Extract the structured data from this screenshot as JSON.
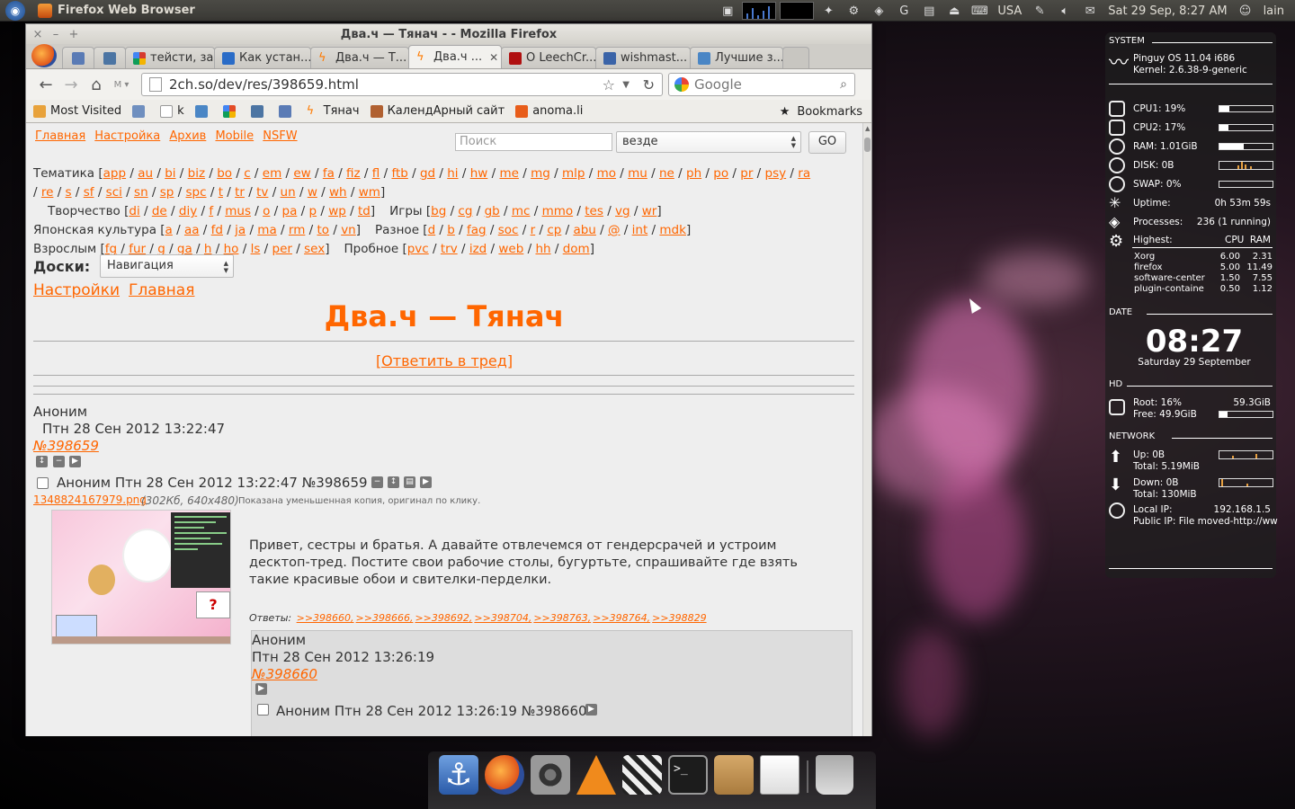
{
  "top_panel": {
    "app_title": "Firefox Web Browser",
    "keyboard_layout": "USA",
    "datetime": "Sat 29 Sep,  8:27 AM",
    "user": "lain"
  },
  "window": {
    "title": "Два.ч — Тянач - - Mozilla Firefox",
    "buttons": [
      "×",
      "–",
      "+"
    ]
  },
  "tabs": [
    {
      "label": "",
      "pinned": true,
      "icon_color": "#5a7bb5"
    },
    {
      "label": "",
      "pinned": true,
      "icon_color": "#4c75a3"
    },
    {
      "label": "тейсти, за...",
      "icon_color": "#d63b2f"
    },
    {
      "label": "Как устан...",
      "icon_color": "#2a6cc7"
    },
    {
      "label": "Два.ч — Т...",
      "icon_color": "#ff7a00"
    },
    {
      "label": "Два.ч ...",
      "icon_color": "#ff7a00",
      "active": true
    },
    {
      "label": "О LeechCr...",
      "icon_color": "#b01010"
    },
    {
      "label": "wishmast...",
      "icon_color": "#3b64a8"
    },
    {
      "label": "Лучшие з...",
      "icon_color": "#4a86c5"
    }
  ],
  "nav": {
    "url": "2ch.so/dev/res/398659.html",
    "search_placeholder": "Google"
  },
  "bookmarks": {
    "items": [
      {
        "label": "Most Visited",
        "icon_color": "#e8a23a"
      },
      {
        "label": "",
        "icon_color": "#6f8fbf"
      },
      {
        "label": "k",
        "icon_color": "#ffffff"
      },
      {
        "label": "",
        "icon_color": "#4a86c5"
      },
      {
        "label": "",
        "icon_color": "#e34c26"
      },
      {
        "label": "",
        "icon_color": "#4c75a3"
      },
      {
        "label": "",
        "icon_color": "#5a7bb5"
      },
      {
        "label": "Тянач",
        "icon_color": "#ff7a00"
      },
      {
        "label": "КалендАрный сайт",
        "icon_color": "#b06030"
      },
      {
        "label": "anoma.li",
        "icon_color": "#e85d1a"
      }
    ],
    "right_label": "Bookmarks"
  },
  "page": {
    "top_links": [
      "Главная",
      "Настройка",
      "Архив",
      "Mobile",
      "NSFW"
    ],
    "search_placeholder": "Поиск",
    "scope_value": "везде",
    "go_label": "GO",
    "board_rows": [
      {
        "cat": "Тематика",
        "boards": [
          "app",
          "au",
          "bi",
          "biz",
          "bo",
          "c",
          "em",
          "ew",
          "fa",
          "fiz",
          "fl",
          "ftb",
          "gd",
          "hi",
          "hw",
          "me",
          "mg",
          "mlp",
          "mo",
          "mu",
          "ne",
          "ph",
          "po",
          "pr",
          "psy",
          "ra"
        ]
      },
      {
        "cat": "",
        "boards": [
          "re",
          "s",
          "sf",
          "sci",
          "sn",
          "sp",
          "spc",
          "t",
          "tr",
          "tv",
          "un",
          "w",
          "wh",
          "wm"
        ],
        "continuation": true
      },
      {
        "cat": "Творчество",
        "boards": [
          "di",
          "de",
          "diy",
          "f",
          "mus",
          "o",
          "pa",
          "p",
          "wp",
          "td"
        ],
        "cat2": "Игры",
        "boards2": [
          "bg",
          "cg",
          "gb",
          "mc",
          "mmo",
          "tes",
          "vg",
          "wr"
        ]
      },
      {
        "cat": "Японская культура",
        "boards": [
          "a",
          "aa",
          "fd",
          "ja",
          "ma",
          "rm",
          "to",
          "vn"
        ],
        "cat2": "Разное",
        "boards2": [
          "d",
          "b",
          "fag",
          "soc",
          "r",
          "cp",
          "abu",
          "@",
          "int",
          "mdk"
        ]
      },
      {
        "cat": "Взрослым",
        "boards": [
          "fg",
          "fur",
          "g",
          "ga",
          "h",
          "ho",
          "ls",
          "per",
          "sex"
        ],
        "cat2": "Пробное",
        "boards2": [
          "pvc",
          "trv",
          "izd",
          "web",
          "hh",
          "dom"
        ]
      }
    ],
    "doski_label": "Доски:",
    "nav_select": "Навигация",
    "link_settings": "Настройки",
    "link_home": "Главная",
    "board_title": "Два.ч — Тянач",
    "reply_link": "[Ответить в тред]",
    "op": {
      "name": "Аноним",
      "date": "Птн 28 Сен 2012 13:22:47",
      "num": "№398659",
      "header": "Аноним  Птн 28 Сен 2012 13:22:47 №398659",
      "file_name": "1348824167979.png",
      "file_meta": "(302Кб, 640x480)",
      "file_note": "Показана уменьшенная копия, оригинал по клику.",
      "body": "Привет, сестры и братья. А давайте отвлечемся от гендерсрачей и устроим десктоп-тред. Постите свои рабочие столы, бугуртьте, спрашивайте где взять такие красивые обои и свителки-перделки.",
      "replies_label": "Ответы:",
      "replies": [
        ">>398660,",
        ">>398666,",
        ">>398692,",
        ">>398704,",
        ">>398763,",
        ">>398764,",
        ">>398829"
      ]
    },
    "reply_post": {
      "name": "Аноним",
      "date": "Птн 28 Сен 2012 13:26:19",
      "num": "№398660",
      "header": "Аноним  Птн 28 Сен 2012 13:26:19 №398660"
    }
  },
  "conky": {
    "system_label": "SYSTEM",
    "os": "Pinguy OS 11.04 i686",
    "kernel": "Kernel: 2.6.38-9-generic",
    "cpu1": "CPU1: 19%",
    "cpu1_pct": 19,
    "cpu2": "CPU2: 17%",
    "cpu2_pct": 17,
    "ram": "RAM: 1.01GiB",
    "ram_pct": 45,
    "disk": "DISK: 0B",
    "swap": "SWAP: 0%",
    "swap_pct": 0,
    "uptime_label": "Uptime:",
    "uptime": "0h 53m 59s",
    "processes_label": "Processes:",
    "processes": "236 (1 running)",
    "highest_label": "Highest:",
    "cpu_col": "CPU",
    "ram_col": "RAM",
    "top": [
      {
        "name": "Xorg",
        "cpu": "6.00",
        "ram": "2.31"
      },
      {
        "name": "firefox",
        "cpu": "5.00",
        "ram": "11.49"
      },
      {
        "name": "software-center",
        "cpu": "1.50",
        "ram": "7.55"
      },
      {
        "name": "plugin-containe",
        "cpu": "0.50",
        "ram": "1.12"
      }
    ],
    "date_label": "DATE",
    "clock": "08:27",
    "date": "Saturday 29 September",
    "hd_label": "HD",
    "root": "Root: 16%",
    "root_size": "59.3GiB",
    "free": "Free: 49.9GiB",
    "root_pct": 16,
    "network_label": "NETWORK",
    "up": "Up: 0B",
    "up_total": "Total: 5.19MiB",
    "down": "Down: 0B",
    "down_total": "Total: 130MiB",
    "local_ip_label": "Local IP:",
    "local_ip": "192.168.1.5",
    "public_ip": "Public IP: File moved-http://ww"
  },
  "dock": {
    "items": [
      "anchor-icon",
      "firefox-icon",
      "speaker-icon",
      "vlc-icon",
      "clapper-icon",
      "terminal-icon",
      "package-icon",
      "files-icon",
      "text-editor-icon",
      "trash-icon"
    ]
  },
  "colors": {
    "link": "#ff6600",
    "title": "#ff6600",
    "page_bg": "#eeeeee"
  }
}
